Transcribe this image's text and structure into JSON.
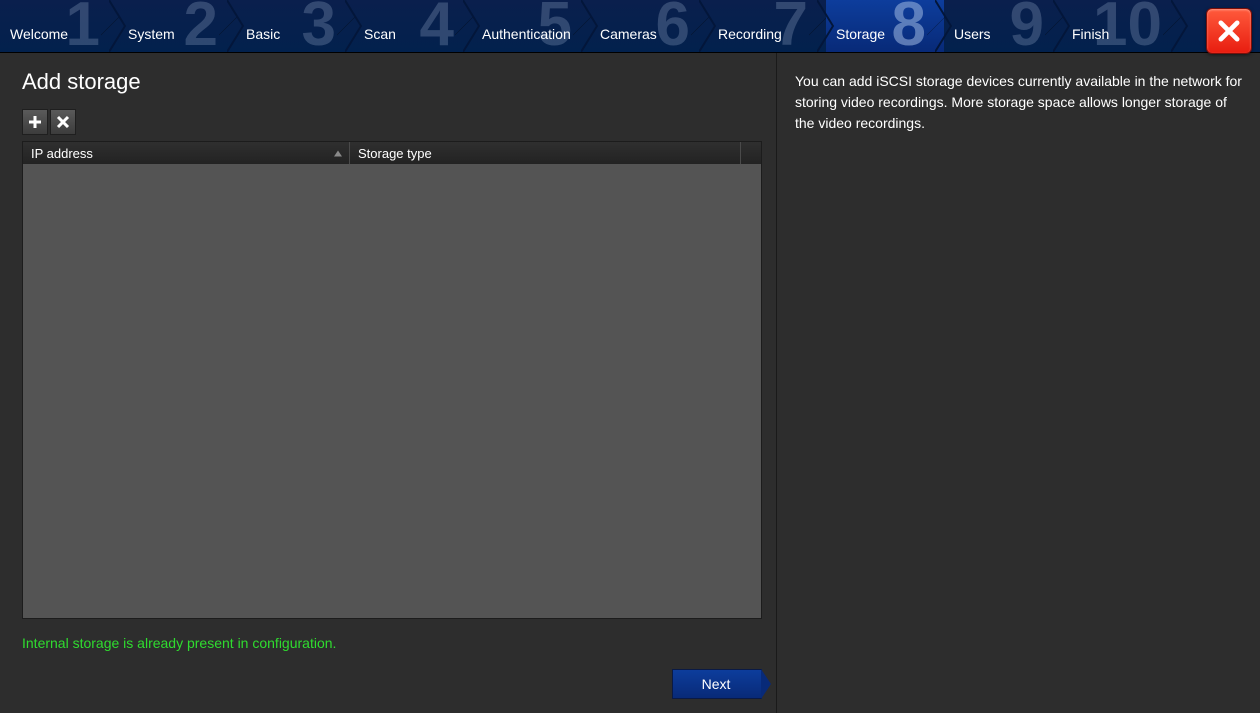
{
  "wizard": {
    "steps": [
      {
        "num": "1",
        "label": "Welcome"
      },
      {
        "num": "2",
        "label": "System"
      },
      {
        "num": "3",
        "label": "Basic"
      },
      {
        "num": "4",
        "label": "Scan"
      },
      {
        "num": "5",
        "label": "Authentication"
      },
      {
        "num": "6",
        "label": "Cameras"
      },
      {
        "num": "7",
        "label": "Recording"
      },
      {
        "num": "8",
        "label": "Storage"
      },
      {
        "num": "9",
        "label": "Users"
      },
      {
        "num": "10",
        "label": "Finish"
      }
    ],
    "active_index": 7
  },
  "page": {
    "title": "Add storage",
    "columns": {
      "ip": "IP address",
      "type": "Storage type"
    },
    "status": "Internal storage is already present in configuration.",
    "next_label": "Next"
  },
  "help": {
    "text": "You can add iSCSI storage devices currently available in the network for storing video recordings. More storage space allows longer storage of the video recordings."
  }
}
